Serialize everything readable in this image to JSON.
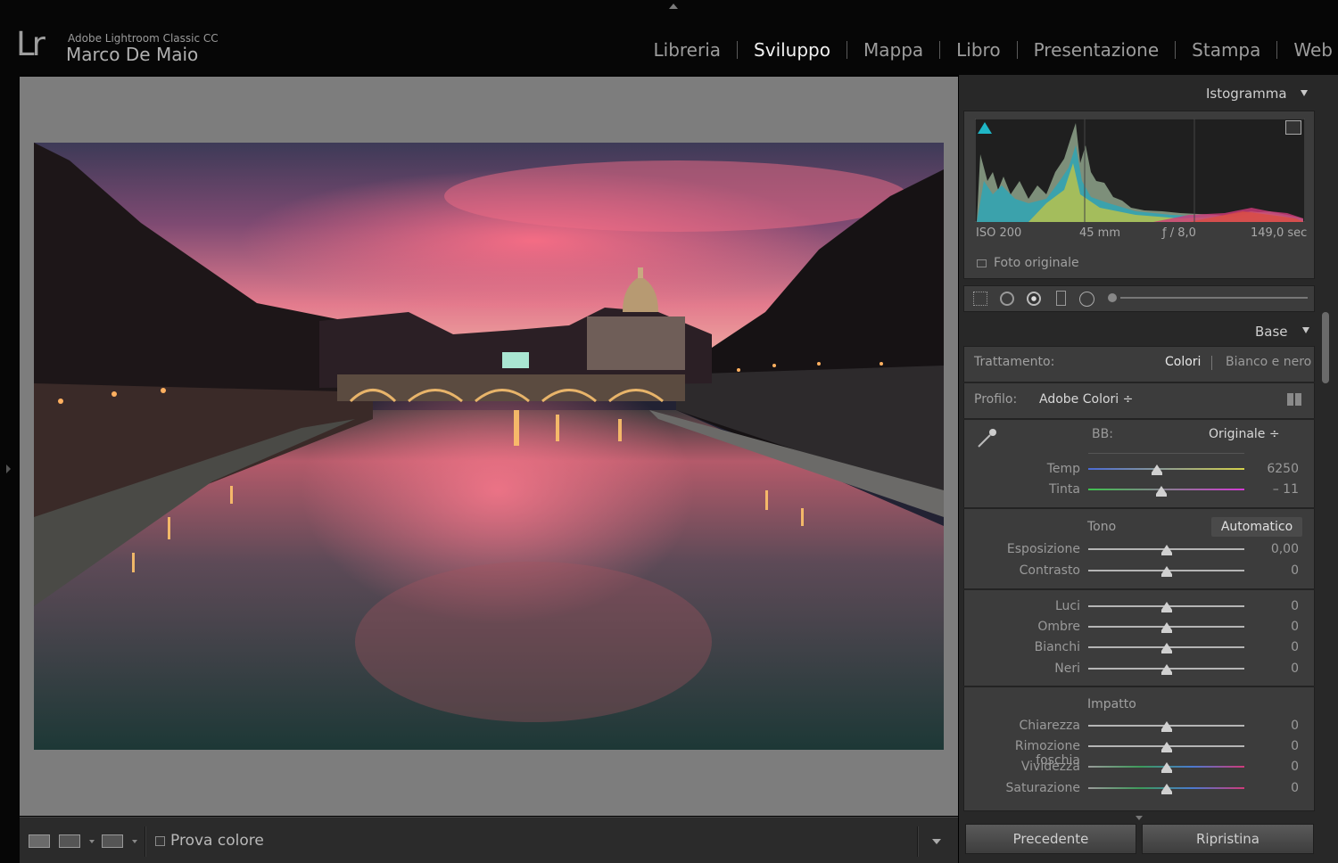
{
  "app": {
    "logo": "Lr",
    "product": "Adobe Lightroom Classic CC",
    "user": "Marco De Maio"
  },
  "modules": [
    "Libreria",
    "Sviluppo",
    "Mappa",
    "Libro",
    "Presentazione",
    "Stampa",
    "Web"
  ],
  "active_module": "Sviluppo",
  "toolbar": {
    "soft_proof_label": "Prova colore",
    "soft_proof_checked": false
  },
  "histogram": {
    "title": "Istogramma",
    "iso": "ISO 200",
    "focal": "45 mm",
    "aperture": "ƒ / 8,0",
    "shutter": "149,0 sec",
    "original_photo_label": "Foto originale"
  },
  "base": {
    "title": "Base",
    "treatment_label": "Trattamento:",
    "treatment_color": "Colori",
    "treatment_bw": "Bianco e nero",
    "profile_label": "Profilo:",
    "profile_value": "Adobe Colori ÷",
    "wb_label": "BB:",
    "wb_value": "Originale ÷",
    "tone_label": "Tono",
    "auto_label": "Automatico",
    "presence_label": "Impatto",
    "sliders": {
      "temp": {
        "label": "Temp",
        "value": "6250",
        "level": 0.44
      },
      "tint": {
        "label": "Tinta",
        "value": "– 11",
        "level": 0.47
      },
      "exposure": {
        "label": "Esposizione",
        "value": "0,00",
        "level": 0.5
      },
      "contrast": {
        "label": "Contrasto",
        "value": "0",
        "level": 0.5
      },
      "highlights": {
        "label": "Luci",
        "value": "0",
        "level": 0.5
      },
      "shadows": {
        "label": "Ombre",
        "value": "0",
        "level": 0.5
      },
      "whites": {
        "label": "Bianchi",
        "value": "0",
        "level": 0.5
      },
      "blacks": {
        "label": "Neri",
        "value": "0",
        "level": 0.5
      },
      "clarity": {
        "label": "Chiarezza",
        "value": "0",
        "level": 0.5
      },
      "dehaze": {
        "label": "Rimozione foschia",
        "value": "0",
        "level": 0.5
      },
      "vibrance": {
        "label": "Vividezza",
        "value": "0",
        "level": 0.5
      },
      "saturation": {
        "label": "Saturazione",
        "value": "0",
        "level": 0.5
      }
    }
  },
  "buttons": {
    "previous": "Precedente",
    "reset": "Ripristina"
  }
}
